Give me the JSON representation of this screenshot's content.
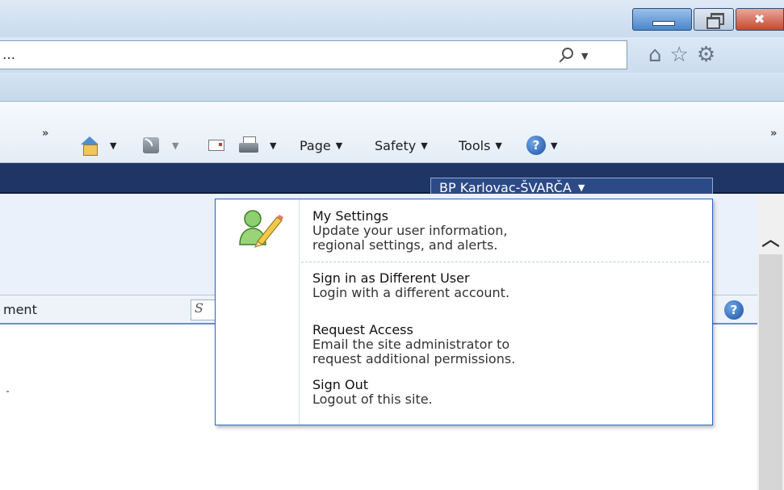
{
  "address_bar": {
    "text": "…"
  },
  "command_bar": {
    "page_label": "Page",
    "safety_label": "Safety",
    "tools_label": "Tools",
    "help_glyph": "?"
  },
  "user_menu": {
    "button_label": "BP Karlovac-ŠVARČA",
    "items": [
      {
        "title": "My Settings",
        "desc_line1": "Update your user information,",
        "desc_line2": "regional settings, and alerts."
      },
      {
        "title": "Sign in as Different User",
        "desc_line1": "Login with a different account."
      },
      {
        "title": "Request Access",
        "desc_line1": "Email the site administrator to",
        "desc_line2": "request additional permissions."
      },
      {
        "title": "Sign Out",
        "desc_line1": "Logout of this site."
      }
    ]
  },
  "page": {
    "tab_text": "ment",
    "search_partial": "S",
    "help_glyph": "?"
  },
  "icons": {
    "search": "search-icon",
    "home": "home-icon",
    "favorites": "star-icon",
    "settings": "gear-icon",
    "feeds": "rss-icon",
    "mail": "mail-icon",
    "print": "print-icon",
    "help": "help-icon",
    "user_settings": "user-settings-icon"
  },
  "colors": {
    "sp_band": "#1f3566",
    "menu_border": "#2a63c9",
    "help_blue": "#1d4f9e"
  }
}
